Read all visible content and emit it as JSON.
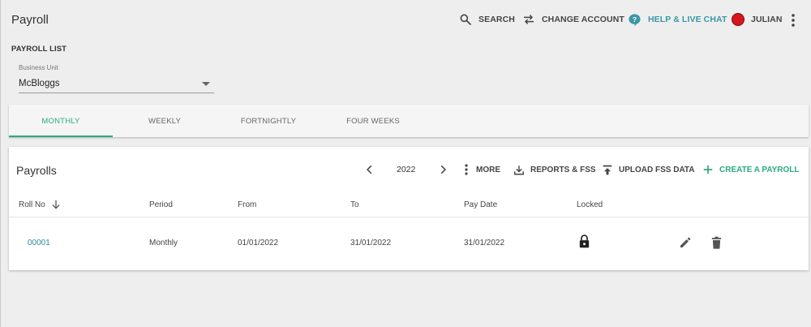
{
  "app": {
    "title": "Payroll"
  },
  "header": {
    "search_label": "SEARCH",
    "change_account_label": "CHANGE ACCOUNT",
    "help_label": "HELP & LIVE CHAT",
    "user_label": "JULIAN"
  },
  "payroll_list": {
    "section_label": "PAYROLL LIST",
    "business_unit": {
      "label": "Business Unit",
      "value": "McBloggs"
    }
  },
  "tabs": [
    {
      "label": "MONTHLY",
      "active": true
    },
    {
      "label": "WEEKLY",
      "active": false
    },
    {
      "label": "FORTNIGHTLY",
      "active": false
    },
    {
      "label": "FOUR WEEKS",
      "active": false
    }
  ],
  "payrolls": {
    "title": "Payrolls",
    "year": "2022",
    "more_label": "MORE",
    "reports_label": "REPORTS & FSS",
    "upload_label": "UPLOAD FSS DATA",
    "create_label": "CREATE A PAYROLL",
    "columns": [
      "Roll No",
      "Period",
      "From",
      "To",
      "Pay Date",
      "Locked"
    ],
    "rows": [
      {
        "roll_no": "00001",
        "period": "Monthly",
        "from": "01/01/2022",
        "to": "31/01/2022",
        "pay_date": "31/01/2022",
        "locked": true
      }
    ]
  },
  "colors": {
    "accent_green": "#2bab7c",
    "help_teal": "#3b97a6",
    "link_teal": "#2a8c9c",
    "avatar_red": "#d8141d",
    "background": "#eeeeee"
  },
  "icons": {
    "search": "search-icon",
    "change_account": "swap-icon",
    "help": "help-chat-icon",
    "avatar": "avatar",
    "menu": "more-vertical-icon",
    "prev": "chevron-left-icon",
    "next": "chevron-right-icon",
    "more": "more-vertical-icon",
    "reports": "download-icon",
    "upload": "upload-icon",
    "create": "plus-icon",
    "sort": "arrow-down-icon",
    "locked": "lock-icon",
    "edit": "pencil-icon",
    "delete": "trash-icon"
  }
}
